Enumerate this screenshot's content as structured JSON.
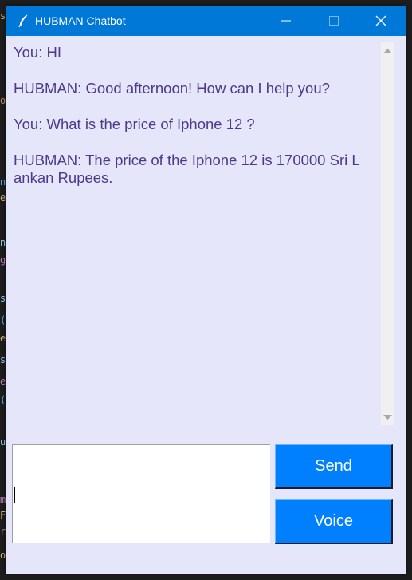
{
  "window": {
    "title": "HUBMAN Chatbot",
    "icon": "feather-icon",
    "titlebar_color": "#0078d7",
    "background_color": "#e6e6fa"
  },
  "chat": {
    "text_color": "#4b3b8a",
    "messages": [
      {
        "line1": "You: HI",
        "line2": ""
      },
      {
        "line1": "HUBMAN: Good afternoon! How can I help you?",
        "line2": ""
      },
      {
        "line1": "You: What is the price of Iphone 12 ?",
        "line2": ""
      },
      {
        "line1": "HUBMAN: The price of the Iphone 12 is 170000 Sri L",
        "line2": "ankan Rupees."
      }
    ]
  },
  "input": {
    "value": "",
    "placeholder": ""
  },
  "buttons": {
    "send_label": "Send",
    "voice_label": "Voice",
    "color": "#0080ff"
  }
}
